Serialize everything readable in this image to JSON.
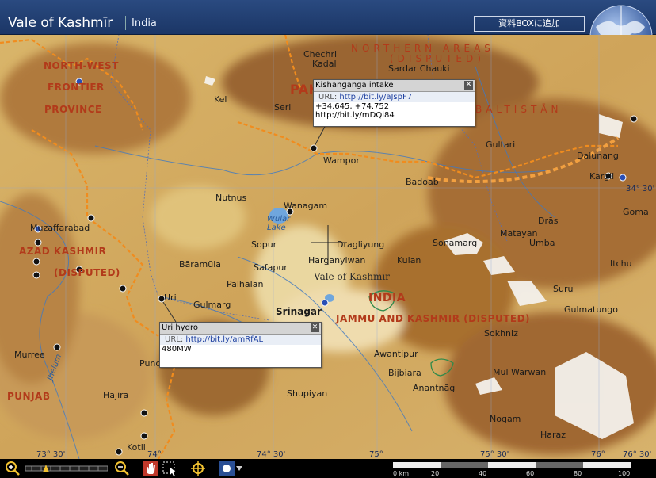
{
  "header": {
    "title": "Vale of Kashmīr",
    "subtitle": "India",
    "add_button": "資料BOXに追加"
  },
  "map": {
    "regions": [
      {
        "text": "NORTH-WEST"
      },
      {
        "text": "FRONTIER"
      },
      {
        "text": "PROVINCE"
      },
      {
        "text": "NORTHERN AREAS"
      },
      {
        "text": "(DISPUTED)"
      },
      {
        "text": "PAK"
      },
      {
        "text": "BALTISTĀN"
      },
      {
        "text": "AZAD KASHMIR"
      },
      {
        "text": "(DISPUTED)"
      },
      {
        "text": "PUNJAB"
      },
      {
        "text": "INDIA"
      },
      {
        "text": "JAMMU AND KASHMIR (DISPUTED)"
      }
    ],
    "places": [
      "Chechri",
      "Kadal",
      "Sardar Chauki",
      "Kel",
      "Seri",
      "Gultari",
      "Dalunang",
      "Kargil",
      "Wampor",
      "Badoab",
      "Drās",
      "Goma",
      "Nutnus",
      "Wanagam",
      "Wular Lake",
      "Muzaffarabad",
      "Sopur",
      "Dragliyung",
      "Sonamarg",
      "Matayan",
      "Umba",
      "Bāramūla",
      "Safapur",
      "Harganyiwan",
      "Kulan",
      "Itchu",
      "Palhalan",
      "Vale of Kashmīr",
      "Uri",
      "Gulmarg",
      "Srinagar",
      "Suru",
      "Gulmatungo",
      "Sokhniz",
      "Murree",
      "Awantipur",
      "Punch",
      "Bijbiara",
      "Mul Warwan",
      "Jhelum",
      "Hajira",
      "Anantnāg",
      "Shupiyan",
      "Nogam",
      "Haraz",
      "Kotli"
    ],
    "coords": [
      "34° 30'",
      "73° 30'",
      "74°",
      "74° 30'",
      "75°",
      "75° 30'",
      "76°",
      "76° 30'"
    ],
    "popups": [
      {
        "title": "Kishanganga intake",
        "url_label": "URL:",
        "url": "http://bit.ly/aJspF7",
        "lines": [
          "+34.645, +74.752",
          "http://bit.ly/mDQi84"
        ]
      },
      {
        "title": "Uri hydro",
        "url_label": "URL:",
        "url": "http://bit.ly/amRfAL",
        "lines": [
          "480MW"
        ]
      }
    ]
  },
  "toolbar": {
    "scale_ticks": [
      "0 km",
      "20",
      "40",
      "60",
      "80",
      "100"
    ]
  },
  "colors": {
    "header": "#1b3666",
    "region_text": "#b23a1a",
    "boundary": "#f08c1e",
    "terrain_low": "#e9d29a",
    "terrain_high": "#a26a2e"
  }
}
